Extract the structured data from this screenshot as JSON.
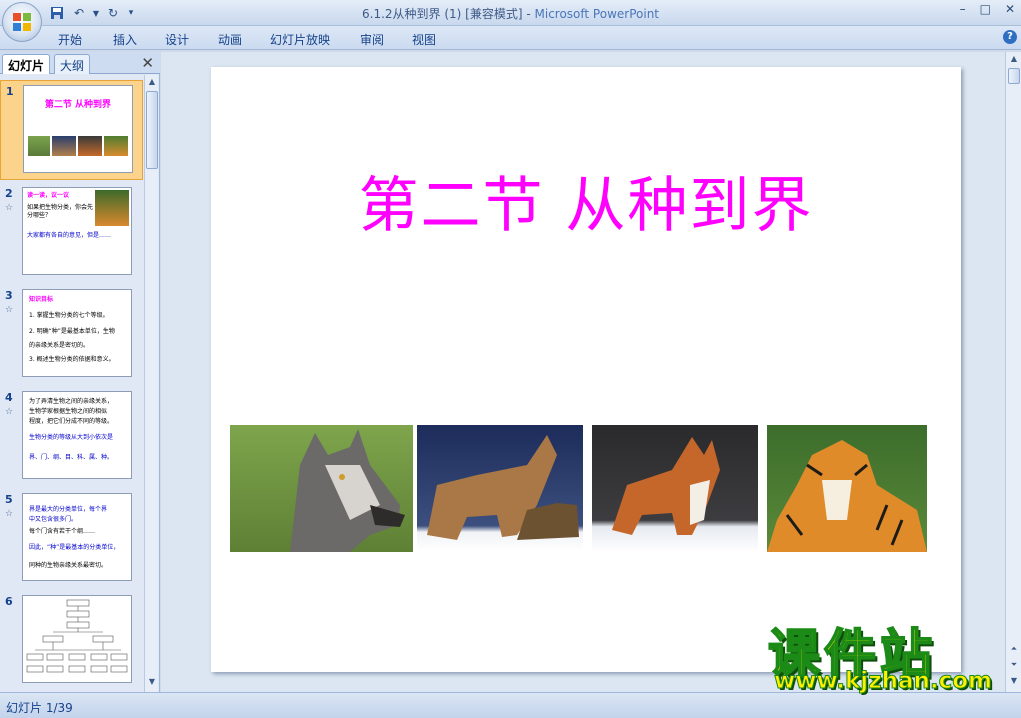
{
  "window": {
    "title": "6.1.2从种到界 (1) [兼容模式]",
    "separator": " - ",
    "app_name": "Microsoft PowerPoint",
    "controls": [
      "–",
      "□",
      "✕"
    ]
  },
  "ribbon": {
    "tabs": [
      "开始",
      "插入",
      "设计",
      "动画",
      "幻灯片放映",
      "审阅",
      "视图"
    ],
    "help": "?"
  },
  "left_pane": {
    "tabs": [
      "幻灯片",
      "大纲"
    ],
    "close": "✕",
    "thumbnails": [
      {
        "num": "1",
        "title": "第二节  从种到界"
      },
      {
        "num": "2",
        "anim": "☆",
        "heading": "读一读，议一议",
        "lines": [
          "如果把生物分类，你会先分哪些？",
          "大家都有各自的意见，但是……"
        ]
      },
      {
        "num": "3",
        "anim": "☆",
        "heading": "知识目标",
        "lines": [
          "1. 掌握生物分类的七个等级。",
          "2. 明确“种”是最基本单位，生物",
          "   的亲缘关系是密切的。",
          "3. 概述生物分类的依据和意义。"
        ]
      },
      {
        "num": "4",
        "anim": "☆",
        "lines": [
          "为了弄清生物之间的亲缘关系，",
          "生物学家根据生物之间的相似",
          "程度，把它们分成不同的等级。",
          "生物分类的等级从大到小依次是",
          "界、门、纲、目、科、属、种。"
        ]
      },
      {
        "num": "5",
        "anim": "☆",
        "lines": [
          "界是最大的分类单位，每个界",
          "中又包含很多门。",
          "每个门含有若干个纲……",
          "因此，“种”是最基本的分类单位，",
          "同种的生物亲缘关系最密切。"
        ]
      },
      {
        "num": "6"
      }
    ]
  },
  "slide": {
    "title": "第二节  从种到界",
    "images": [
      "wolf-photo",
      "howling-wolves-photo",
      "fox-photo",
      "tiger-photo"
    ]
  },
  "status": {
    "slide_counter": "幻灯片 1/39"
  },
  "watermark": {
    "brand": "课件站",
    "url": "www.kjzhan.com"
  }
}
